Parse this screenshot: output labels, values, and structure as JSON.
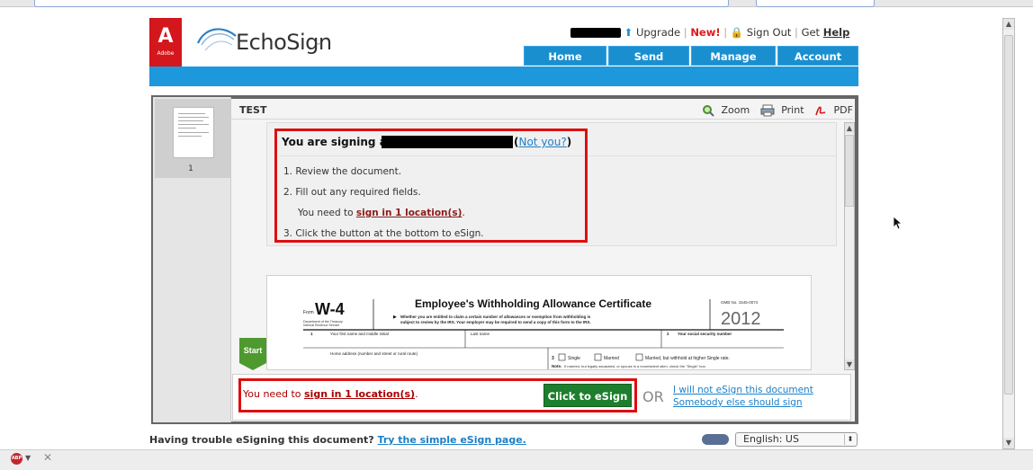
{
  "header": {
    "adobe_logo_text": "Adobe",
    "brand": "EchoSign",
    "brand_tm": "™",
    "links": {
      "upgrade": "Upgrade",
      "new": "New!",
      "sign_out": "Sign Out",
      "get": "Get",
      "help": "Help"
    },
    "nav": [
      "Home",
      "Send",
      "Manage",
      "Account"
    ]
  },
  "viewer": {
    "doc_title": "TEST",
    "thumbnail_page": "1",
    "toolbar": {
      "zoom": "Zoom",
      "print": "Print",
      "pdf": "PDF"
    }
  },
  "instructions": {
    "title": "You are signing as",
    "not_you": "Not you?",
    "steps": [
      "1.  Review the document.",
      "2.  Fill out any required fields.",
      "3.  Click the button at the bottom to eSign."
    ],
    "need_prefix": "You need to",
    "need_link": "sign in 1 location(s)",
    "need_suffix": "."
  },
  "form": {
    "form_label": "Form",
    "form_code": "W-4",
    "dept": "Department of the Treasury",
    "irs": "Internal Revenue Service",
    "title": "Employee's Withholding Allowance Certificate",
    "line1": "Whether you are entitled to claim a certain number of allowances or exemption from withholding is",
    "line2": "subject to review by the IRS. Your employer may be required to send a copy of this form to the IRS.",
    "omb": "OMB No. 1545-0074",
    "year": "2012",
    "field1_num": "1",
    "field1": "Your first name and middle initial",
    "last_name": "Last name",
    "field2_num": "2",
    "field2": "Your social security number",
    "home_address": "Home address (number and street or rural route)",
    "field3_num": "3",
    "single": "Single",
    "married": "Married",
    "married_higher": "Married, but withhold at higher Single rate.",
    "note": "Note.",
    "note_text": "If married, but legally separated, or spouse is a nonresident alien, check the \"Single\" box.",
    "start_tag": "Start"
  },
  "sign_bar": {
    "need_prefix": "You need to",
    "need_link": "sign in 1 location(s)",
    "need_suffix": ".",
    "button": "Click to eSign",
    "or": "OR",
    "alt1": "I will not eSign this document",
    "alt2": "Somebody else should sign"
  },
  "footer": {
    "trouble": "Having trouble eSigning this document?",
    "simple_link": "Try the simple eSign page.",
    "language": "English: US"
  },
  "colors": {
    "nav_blue": "#1a8fd0",
    "highlight_red": "#dd0f0f",
    "esign_green": "#1d7f2e",
    "adobe_red": "#d4161d"
  }
}
